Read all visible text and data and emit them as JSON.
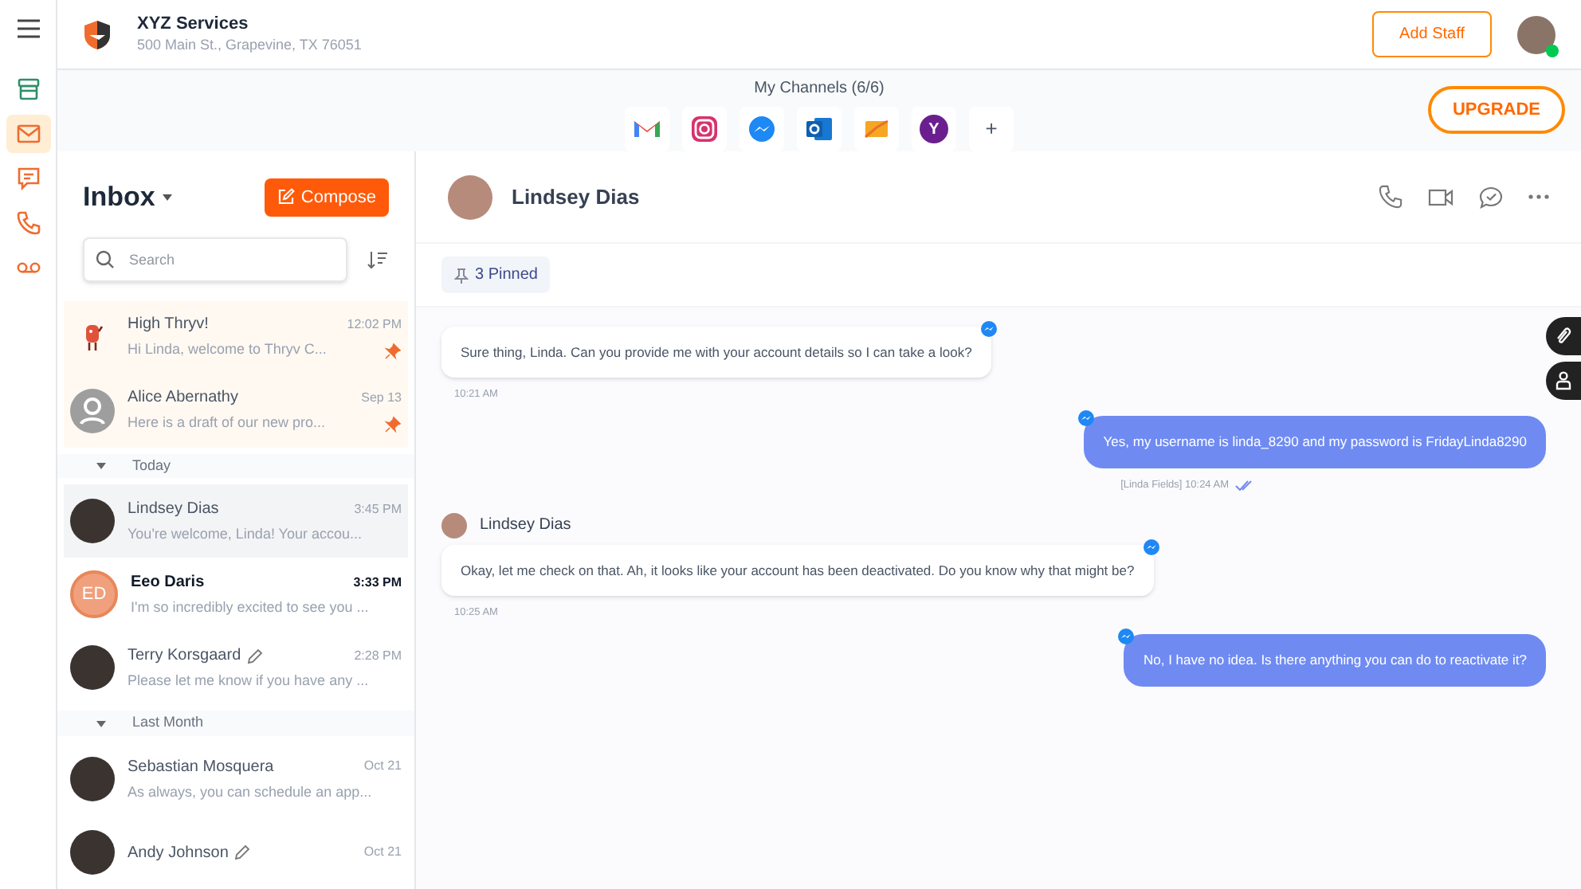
{
  "business": {
    "name": "XYZ Services",
    "address": "500 Main St., Grapevine, TX 76051"
  },
  "header": {
    "add_staff": "Add Staff",
    "user_online": true
  },
  "rail": [
    {
      "kind": "store",
      "selected": false
    },
    {
      "kind": "mail",
      "selected": true
    },
    {
      "kind": "chat",
      "selected": false
    },
    {
      "kind": "phone",
      "selected": false
    },
    {
      "kind": "voicemail",
      "selected": false
    }
  ],
  "channels": {
    "title": "My Channels (6/6)",
    "items": [
      {
        "kind": "gmail"
      },
      {
        "kind": "instagram"
      },
      {
        "kind": "messenger"
      },
      {
        "kind": "outlook"
      },
      {
        "kind": "mail"
      },
      {
        "kind": "yahoo",
        "glyph": "Y"
      }
    ],
    "add": "+",
    "upgrade": "UPGRADE"
  },
  "inbox": {
    "title": "Inbox",
    "compose": "Compose",
    "search": {
      "placeholder": "Search"
    }
  },
  "conversations": [
    {
      "kind": "conversation",
      "name": "High Thryv!",
      "time": "12:02 PM",
      "preview": "Hi Linda, welcome to Thryv C...",
      "pinned": true,
      "unread": false,
      "selected": false,
      "draft": false,
      "avatar": {
        "kind": "mascot"
      }
    },
    {
      "kind": "conversation",
      "name": "Alice Abernathy",
      "time": "Sep 13",
      "preview": "Here is a draft of our new pro...",
      "pinned": true,
      "unread": false,
      "selected": false,
      "draft": false,
      "avatar": {
        "kind": "generic"
      }
    },
    {
      "kind": "section",
      "label": "Today",
      "expanded": true
    },
    {
      "kind": "conversation",
      "name": "Lindsey Dias",
      "time": "3:45 PM",
      "preview": "You're welcome, Linda! Your accou...",
      "pinned": false,
      "unread": false,
      "selected": true,
      "draft": false,
      "avatar": {
        "kind": "photo"
      }
    },
    {
      "kind": "conversation",
      "name": "Eeo Daris",
      "time": "3:33 PM",
      "preview": "I'm so incredibly excited to see you ...",
      "pinned": false,
      "unread": true,
      "selected": false,
      "draft": false,
      "avatar": {
        "kind": "initials",
        "initials": "ED"
      }
    },
    {
      "kind": "conversation",
      "name": "Terry Korsgaard",
      "time": "2:28 PM",
      "preview": "Please let me know if you have any ...",
      "pinned": false,
      "unread": false,
      "selected": false,
      "draft": true,
      "avatar": {
        "kind": "photo"
      }
    },
    {
      "kind": "section",
      "label": "Last Month",
      "expanded": true
    },
    {
      "kind": "conversation",
      "name": "Sebastian Mosquera",
      "time": "Oct 21",
      "preview": "As always, you can schedule an app...",
      "pinned": false,
      "unread": false,
      "selected": false,
      "draft": false,
      "avatar": {
        "kind": "photo"
      }
    },
    {
      "kind": "conversation",
      "name": "Andy Johnson",
      "time": "Oct 21",
      "pinned": false,
      "unread": false,
      "selected": false,
      "draft": true,
      "avatar": {
        "kind": "photo"
      }
    }
  ],
  "chat": {
    "contact": "Lindsey Dias",
    "pinned": "3 Pinned"
  },
  "messages": [
    {
      "kind": "incoming",
      "text": "Sure thing, Linda. Can you provide me with your account details so I can take a look?",
      "time": "10:21 AM"
    },
    {
      "kind": "outgoing",
      "text": "Yes, my username is linda_8290 and my password is FridayLinda8290",
      "time": "[Linda Fields] 10:24 AM",
      "read": true
    },
    {
      "kind": "sender",
      "name": "Lindsey Dias"
    },
    {
      "kind": "incoming",
      "text": "Okay, let me check on that. Ah, it looks like your account has been deactivated. Do you know why that might be?",
      "time": "10:25 AM"
    },
    {
      "kind": "outgoing",
      "text": "No, I have no idea. Is there anything you can do to reactivate it?",
      "read": false
    }
  ]
}
